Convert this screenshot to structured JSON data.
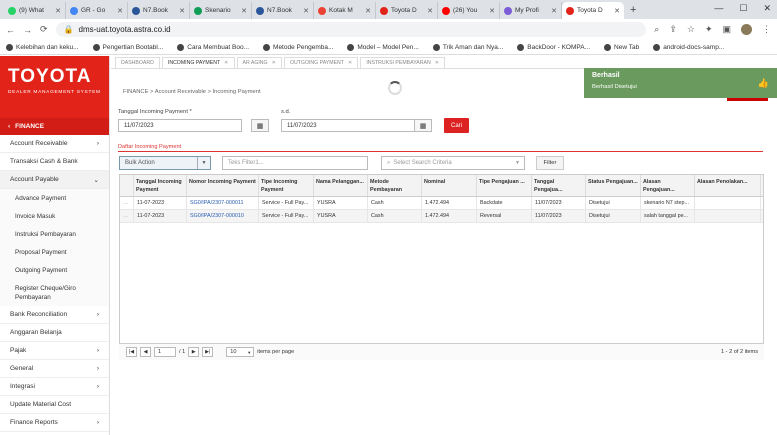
{
  "browser": {
    "tabs": [
      {
        "label": "(9) What",
        "color": "#25d366"
      },
      {
        "label": "GR - Go",
        "color": "#4285f4"
      },
      {
        "label": "N7.Book",
        "color": "#2b579a"
      },
      {
        "label": "Skenario",
        "color": "#0f9d58"
      },
      {
        "label": "N7.Book",
        "color": "#2b579a"
      },
      {
        "label": "Kotak M",
        "color": "#ea4335"
      },
      {
        "label": "Toyota D",
        "color": "#e2231a"
      },
      {
        "label": "(26) You",
        "color": "#ff0000"
      },
      {
        "label": "My Profi",
        "color": "#7b5cd6"
      },
      {
        "label": "Toyota D",
        "color": "#e2231a"
      }
    ],
    "new_tab": "+",
    "url": "dms-uat.toyota.astra.co.id",
    "bookmarks": [
      "Kelebihan dan keku...",
      "Pengertian Bootabl...",
      "Cara Membuat Boo...",
      "Metode Pengemba...",
      "Model – Model Pen...",
      "Trik Aman dan Nya...",
      "BackDoor - KOMPA...",
      "New Tab",
      "android-docs-samp..."
    ]
  },
  "sidebar": {
    "brand": "TOYOTA",
    "brand_sub": "DEALER MANAGEMENT SYSTEM",
    "section": "FINANCE",
    "items_top": [
      "Account Receivable",
      "Transaksi Cash & Bank",
      "Account Payable"
    ],
    "sub_items": [
      "Advance Payment",
      "Invoice Masuk",
      "Instruksi Pembayaran",
      "Proposal Payment",
      "Outgoing Payment",
      "Register Cheque/Giro Pembayaran"
    ],
    "items_bottom": [
      "Bank Reconciliation",
      "Anggaran Belanja",
      "Pajak",
      "General",
      "Integrasi",
      "Update Material Cost",
      "Finance Reports"
    ]
  },
  "page_tabs": [
    "DASHBOARD",
    "INCOMING PAYMENT",
    "AR AGING",
    "OUTGOING PAYMENT",
    "INSTRUKSI PEMBAYARAN"
  ],
  "breadcrumb": "FINANCE  >  Account Receivable  >  Incoming Payment",
  "toast": {
    "title": "Berhasil",
    "message": "Berhasil Disetujui"
  },
  "form": {
    "date_label": "Tanggal Incoming Payment *",
    "sd_label": "s.d.",
    "date_from": "11/07/2023",
    "date_to": "11/07/2023",
    "search_button": "Cari"
  },
  "list_title": "Daftar Incoming Payment",
  "toolbar": {
    "bulk_placeholder": "Bulk Action",
    "text_filter_placeholder": "Teks Filter1...",
    "criteria_placeholder": "Select Search Criteria",
    "filter_button": "Filter"
  },
  "table": {
    "headers": [
      "Tanggal Incoming Payment",
      "Nomor Incoming Payment",
      "Tipe Incoming Payment",
      "Nama Pelanggan...",
      "Metode Pembayaran",
      "Nominal",
      "Tipe Pengajuan ...",
      "Tanggal Pengajua...",
      "Status Pengajuan...",
      "Alasan Pengajuan...",
      "Alasan Penolakan..."
    ],
    "rows": [
      [
        "11-07-2023",
        "SG0/IPA/2307-000011",
        "Service - Full Pay...",
        "YUSRA",
        "Cash",
        "1.472.494",
        "Backdate",
        "11/07/2023",
        "Disetujui",
        "skenario N7 step...",
        ""
      ],
      [
        "11-07-2023",
        "SG0/IPA/2307-000010",
        "Service - Full Pay...",
        "YUSRA",
        "Cash",
        "1.472.494",
        "Reversal",
        "11/07/2023",
        "Disetujui",
        "salah tanggal pe...",
        ""
      ]
    ]
  },
  "pager": {
    "page": "1",
    "of": "/ 1",
    "per_page": "10",
    "per_page_label": "items per page",
    "count": "1 - 2 of 2 items"
  }
}
